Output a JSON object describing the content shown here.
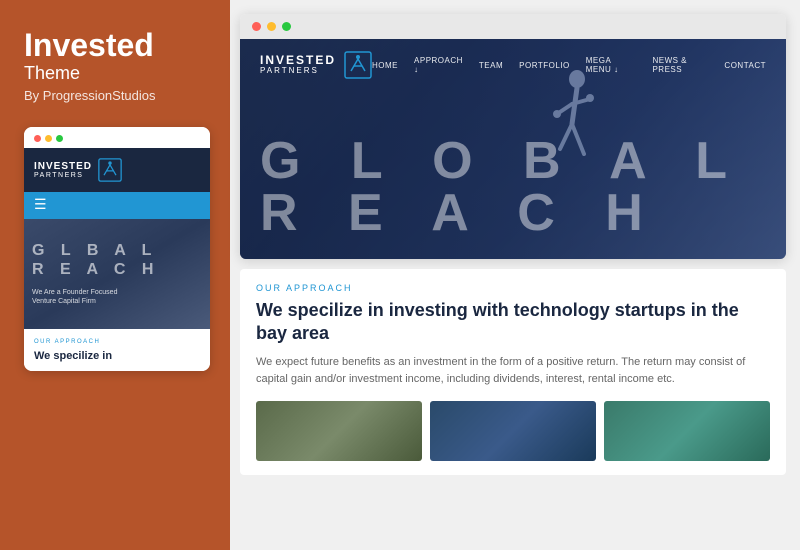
{
  "sidebar": {
    "title": "Invested",
    "subtitle": "Theme",
    "by": "By ProgressionStudios"
  },
  "mobile": {
    "logo_text": "INVESTED",
    "logo_sub": "PARTNERS",
    "hero_line1": "G  L  B  A  L",
    "hero_line2": "R  E  A  C  H",
    "tagline_line1": "We Are a Founder Focused",
    "tagline_line2": "Venture Capital Firm",
    "approach_label": "OUR APPROACH",
    "approach_title": "We specilize in"
  },
  "desktop": {
    "logo_text": "INVESTED",
    "logo_sub": "PARTNERS",
    "nav_items": [
      "HOME",
      "APPROACH ↓",
      "TEAM",
      "PORTFOLIO",
      "MEGA MENU ↓",
      "NEWS & PRESS",
      "CONTACT"
    ],
    "hero_line1": "G L O B A L",
    "hero_line2": "R E A C H",
    "approach_label": "OUR APPROACH",
    "approach_heading": "We specilize in investing with technology startups in the bay area",
    "approach_body": "We expect future benefits as an investment in the form of a positive return. The return may consist of capital gain and/or investment income, including dividends, interest, rental income etc."
  },
  "colors": {
    "sidebar_bg": "#b5542a",
    "navy": "#1a2740",
    "blue": "#2196d3"
  }
}
